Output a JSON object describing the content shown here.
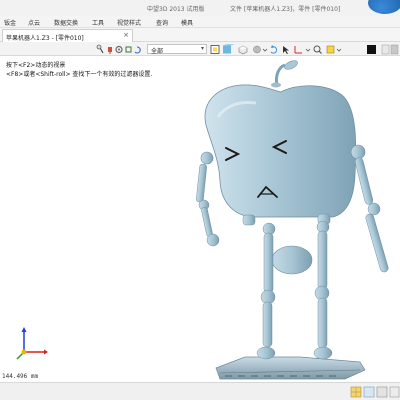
{
  "titlebar": {
    "app_title": "中望3D 2013 试用版",
    "document_info": "文件 [苹果机器人1.Z3]，零件 [零件010]"
  },
  "menubar": {
    "items": [
      "钣金",
      "点云",
      "数据交换",
      "工具",
      "视觉样式",
      "查询",
      "模具"
    ]
  },
  "tabs": [
    {
      "label": "苹果机器人1.Z3 - [零件010]",
      "close": "×"
    }
  ],
  "toolbar": {
    "filter_value": "全部",
    "icons": [
      "pin-icon",
      "paint-icon",
      "settings-icon",
      "link-icon",
      "refresh-icon",
      "filter-icon",
      "frame-icon",
      "shaded-view-icon",
      "view-cube-icon",
      "display-mode-icon",
      "rotate-icon",
      "arrow-icon",
      "dimension-icon",
      "zoom-icon",
      "selection-icon",
      "color-black-icon",
      "color-swatch-icon"
    ]
  },
  "viewport": {
    "hint_line1": "按下<F2>动态的视景",
    "hint_line2": "<F8>或者<Shift-roll> 查找下一个有效的过滤器设置.",
    "distance_readout": "144.496 mm",
    "model_color": "#a9c7d6",
    "triad_colors": {
      "x": "#d42020",
      "y": "#2a9d2a",
      "z": "#1f3fd6"
    }
  },
  "statusbar": {
    "icons": [
      "grid-icon",
      "snap-icon",
      "layer-icon",
      "output-icon"
    ]
  }
}
